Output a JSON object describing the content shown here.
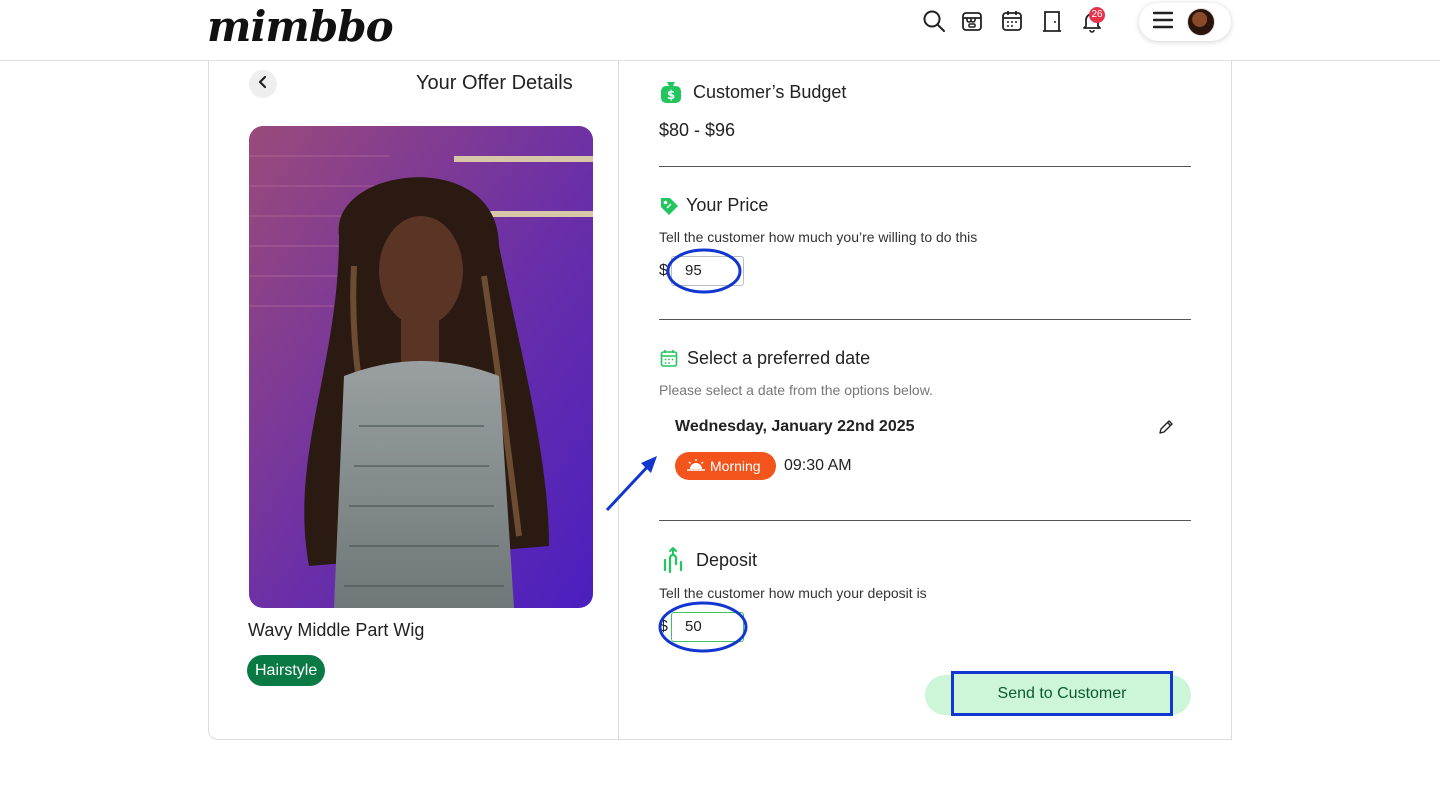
{
  "header": {
    "logo": "mimbbo",
    "notification_count": "26",
    "icons": [
      "search-icon",
      "shop-icon",
      "calendar-icon",
      "door-icon",
      "bell-icon",
      "menu-icon"
    ]
  },
  "left": {
    "title": "Your Offer Details",
    "product_name": "Wavy Middle Part Wig",
    "category": "Hairstyle"
  },
  "budget": {
    "title": "Customer’s Budget",
    "range": "$80 - $96"
  },
  "price": {
    "title": "Your Price",
    "hint": "Tell the customer how much you’re willing to do this",
    "currency": "$",
    "value": "95"
  },
  "date": {
    "title": "Select a preferred date",
    "hint": "Please select a date from the options below.",
    "selected": "Wednesday, January 22nd 2025",
    "period": "Morning",
    "time": "09:30 AM"
  },
  "deposit": {
    "title": "Deposit",
    "hint": "Tell the customer how much your deposit is",
    "currency": "$",
    "value": "50"
  },
  "actions": {
    "send_label": "Send to Customer"
  },
  "colors": {
    "accent_green": "#22c55e",
    "chip_green": "#0a7a45",
    "morning_orange": "#f2541b",
    "button_bg": "#cdf5d8",
    "annotation_blue": "#1236d0"
  }
}
